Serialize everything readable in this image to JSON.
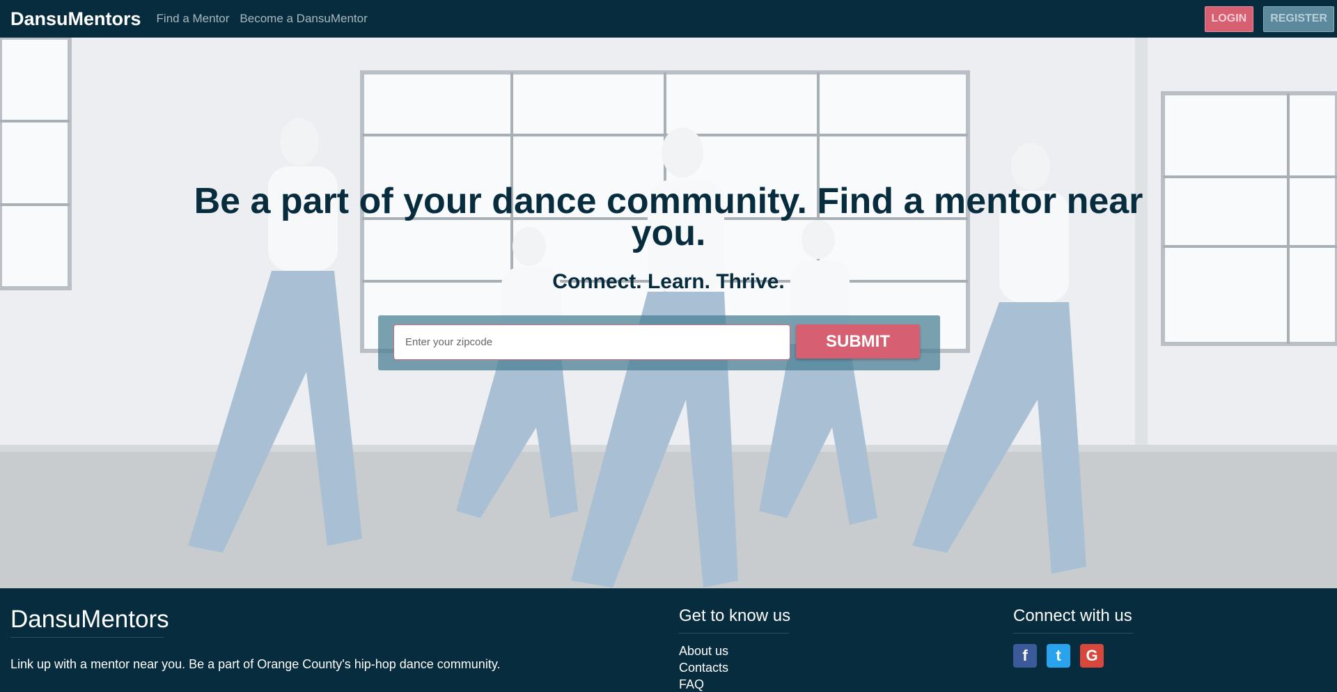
{
  "navbar": {
    "brand": "DansuMentors",
    "links": [
      "Find a Mentor",
      "Become a DansuMentor"
    ],
    "login_label": "LOGIN",
    "register_label": "REGISTER"
  },
  "hero": {
    "title": "Be a part of your dance community. Find a mentor near you.",
    "subtitle": "Connect. Learn. Thrive.",
    "zip_placeholder": "Enter your zipcode",
    "zip_value": "",
    "submit_label": "SUBMIT",
    "background_description": "dancers-in-bright-studio-photo"
  },
  "footer": {
    "brand": "DansuMentors",
    "tagline": "Link up with a mentor near you. Be a part of Orange County's hip-hop dance community.",
    "get_to_know": {
      "heading": "Get to know us",
      "links": [
        "About us",
        "Contacts",
        "FAQ"
      ]
    },
    "connect": {
      "heading": "Connect with us",
      "icons": [
        {
          "name": "facebook-icon",
          "glyph": "f",
          "color": "#3b5a9a"
        },
        {
          "name": "twitter-icon",
          "glyph": "t",
          "color": "#2aa3ef"
        },
        {
          "name": "google-icon",
          "glyph": "G",
          "color": "#d8473b"
        }
      ]
    }
  },
  "colors": {
    "primary_dark": "#062c3d",
    "accent_pink": "#d75f72",
    "accent_teal": "#5c8a9c"
  }
}
